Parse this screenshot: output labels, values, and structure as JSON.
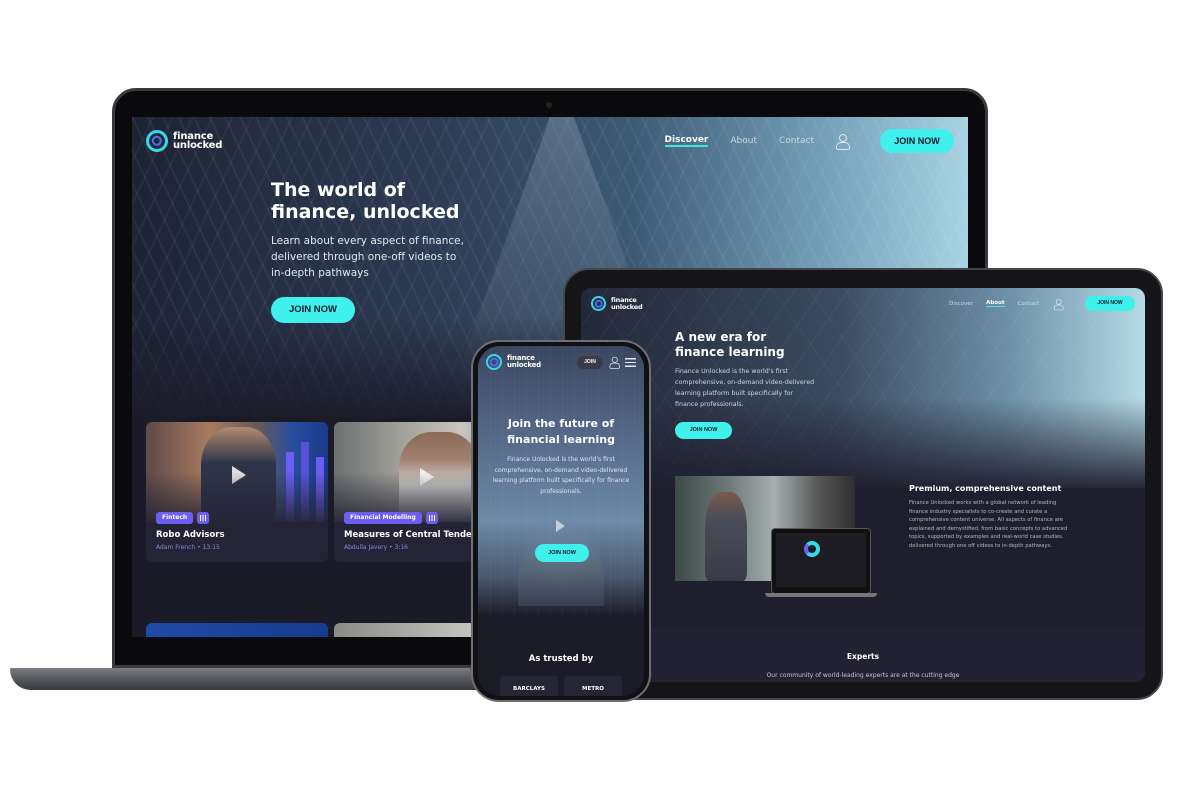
{
  "brand": {
    "name_line1": "finance",
    "name_line2": "unlocked",
    "accent_color": "#3ff0ec",
    "tag_color": "#6b5ef0"
  },
  "laptop": {
    "nav": {
      "links": [
        {
          "label": "Discover",
          "active": true
        },
        {
          "label": "About",
          "active": false
        },
        {
          "label": "Contact",
          "active": false
        }
      ],
      "user_icon": "user-icon",
      "cta": "JOIN NOW"
    },
    "hero": {
      "title_line1": "The world of",
      "title_line2": "finance, unlocked",
      "subtitle": "Learn about every aspect of finance, delivered through one-off videos to in-depth pathways",
      "cta": "JOIN NOW"
    },
    "cards": [
      {
        "tag": "Fintech",
        "title": "Robo Advisors",
        "meta": "Adam French • 13:15",
        "icon": "play-icon"
      },
      {
        "tag": "Financial Modelling",
        "title": "Measures of Central Tendencies",
        "meta": "Abdulla Javery • 3:16",
        "icon": "play-icon"
      }
    ]
  },
  "tablet": {
    "nav": {
      "links": [
        {
          "label": "Discover",
          "active": false
        },
        {
          "label": "About",
          "active": true
        },
        {
          "label": "Contact",
          "active": false
        }
      ],
      "cta": "JOIN NOW"
    },
    "hero": {
      "title_line1": "A new era for",
      "title_line2": "finance learning",
      "subtitle": "Finance Unlocked is the world's first comprehensive, on-demand video-delivered learning platform built specifically for finance professionals.",
      "cta": "JOIN NOW"
    },
    "feature": {
      "title": "Premium, comprehensive content",
      "body": "Finance Unlocked works with a global network of leading finance industry specialists to co-create and curate a comprehensive content universe. All aspects of finance are explained and demystified, from basic concepts to advanced topics, supported by examples and real-world case studies, delivered through one off videos to in-depth pathways."
    },
    "experts": {
      "title": "Experts",
      "text": "Our community of world-leading experts are at the cutting edge"
    }
  },
  "phone": {
    "nav": {
      "join_label": "JOIN"
    },
    "hero": {
      "title_line1": "Join the future of",
      "title_line2": "financial learning",
      "subtitle": "Finance Unlocked is the world's first comprehensive, on-demand video-delivered learning platform built specifically for finance professionals.",
      "cta": "JOIN NOW"
    },
    "trusted": {
      "title": "As trusted by",
      "logos": [
        "BARCLAYS",
        "METRO"
      ]
    }
  }
}
